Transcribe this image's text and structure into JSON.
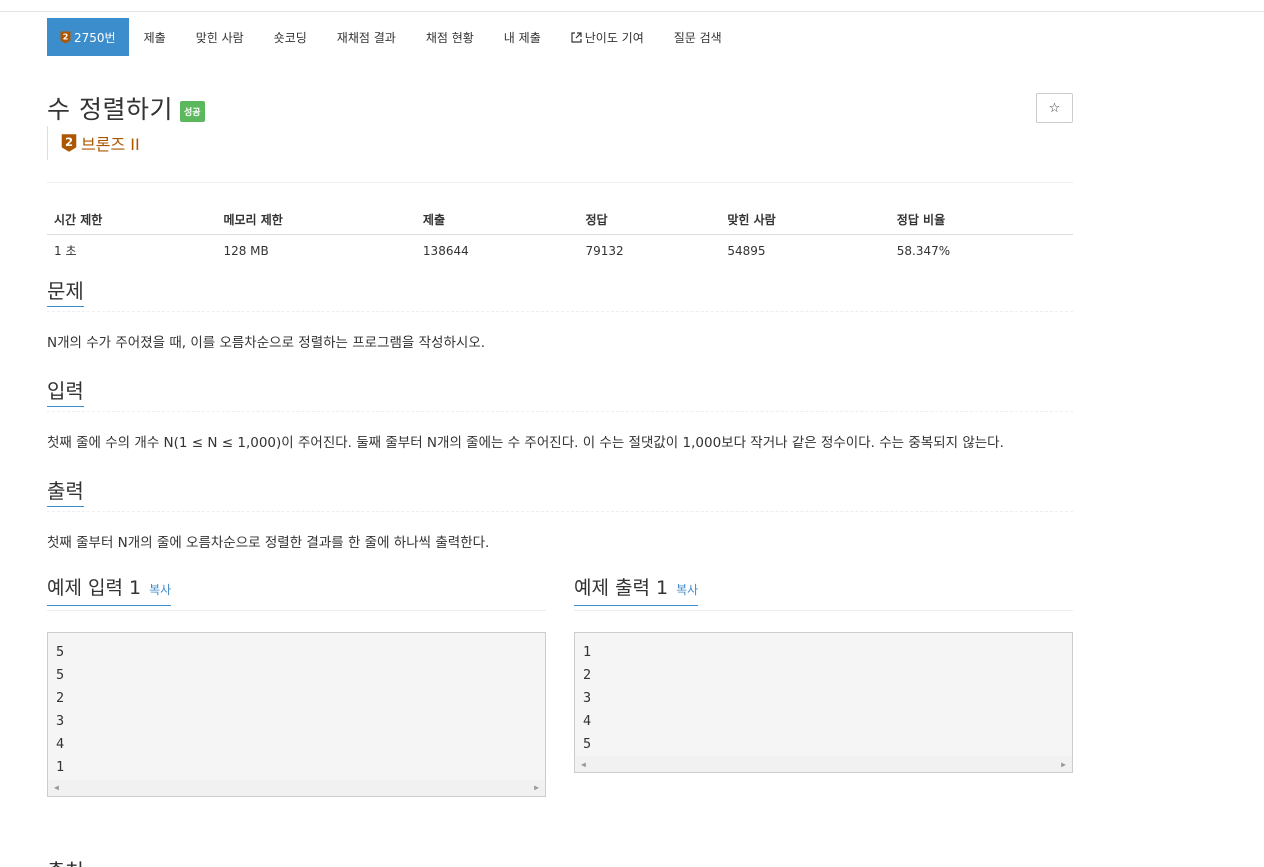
{
  "nav": {
    "problem_number": "2750번",
    "tabs": [
      "제출",
      "맞힌 사람",
      "숏코딩",
      "재채점 결과",
      "채점 현황",
      "내 제출"
    ],
    "difficulty_tab": "난이도 기여",
    "question_tab": "질문 검색"
  },
  "problem": {
    "title": "수 정렬하기",
    "status_badge": "성공",
    "star": "☆",
    "tier_label": "브론즈 II",
    "tier_color": "#ad5600"
  },
  "info_table": {
    "headers": [
      "시간 제한",
      "메모리 제한",
      "제출",
      "정답",
      "맞힌 사람",
      "정답 비율"
    ],
    "values": [
      "1 초",
      "128 MB",
      "138644",
      "79132",
      "54895",
      "58.347%"
    ]
  },
  "sections": {
    "problem_title": "문제",
    "problem_text": "N개의 수가 주어졌을 때, 이를 오름차순으로 정렬하는 프로그램을 작성하시오.",
    "input_title": "입력",
    "input_text": "첫째 줄에 수의 개수 N(1 ≤ N ≤ 1,000)이 주어진다. 둘째 줄부터 N개의 줄에는 수 주어진다. 이 수는 절댓값이 1,000보다 작거나 같은 정수이다. 수는 중복되지 않는다.",
    "output_title": "출력",
    "output_text": "첫째 줄부터 N개의 줄에 오름차순으로 정렬한 결과를 한 줄에 하나씩 출력한다."
  },
  "samples": {
    "input_title": "예제 입력 1",
    "output_title": "예제 출력 1",
    "copy_label": "복사",
    "input_lines": [
      "5",
      "5",
      "2",
      "3",
      "4",
      "1"
    ],
    "output_lines": [
      "1",
      "2",
      "3",
      "4",
      "5"
    ]
  },
  "next_section_hint": "출처"
}
